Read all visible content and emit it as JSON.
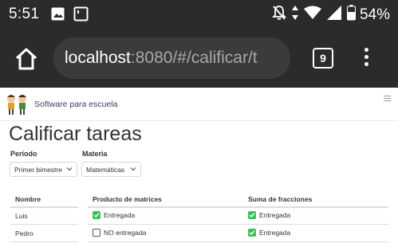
{
  "status_bar": {
    "time": "5:51",
    "battery_percent": "54%",
    "icons": [
      "gallery-icon",
      "square-icon",
      "mute-icon",
      "data-arrows-icon",
      "wifi-icon",
      "signal-icon",
      "battery-icon"
    ]
  },
  "browser": {
    "url_host": "localhost",
    "url_rest": ":8080/#/calificar/t",
    "tab_count": "9"
  },
  "app": {
    "brand": "Software para escuela"
  },
  "page": {
    "title": "Calificar tareas",
    "filters": {
      "period_label": "Período",
      "period_value": "Primer bimestre",
      "subject_label": "Materia",
      "subject_value": "Matemáticas"
    },
    "table": {
      "headers": [
        "Nombre",
        "Producto de matrices",
        "Suma de fracciones"
      ],
      "rows": [
        {
          "name": "Luis",
          "c1": {
            "checked": true,
            "label": "Entregada"
          },
          "c2": {
            "checked": true,
            "label": "Entregada"
          }
        },
        {
          "name": "Pedro",
          "c1": {
            "checked": false,
            "label": "NO entregada"
          },
          "c2": {
            "checked": true,
            "label": "Entregada"
          }
        }
      ]
    }
  },
  "colors": {
    "status_bg": "#2b2b2b",
    "urlbar_bg": "#3b3b3b",
    "checkbox_on": "#3fbf5a",
    "brand_text": "#3b3b5e"
  }
}
